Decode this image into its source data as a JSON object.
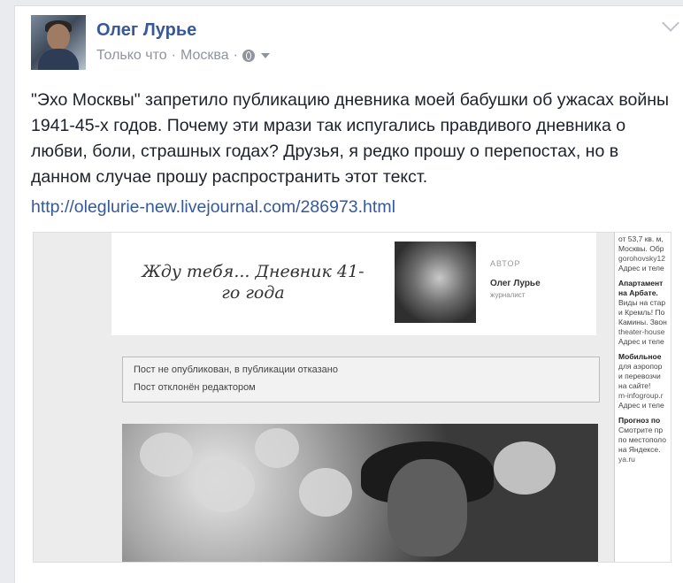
{
  "post": {
    "author": "Олег Лурье",
    "time": "Только что",
    "separator": "·",
    "location": "Москва",
    "privacy_icon": "globe-icon",
    "text": "\"Эхо Москвы\" запретило публикацию дневника моей бабушки об ужасах войны 1941-45-х годов. Почему эти мрази так испугались правдивого дневника о любви, боли, страшных годах? Друзья, я редко прошу о перепостах, но в данном случае прошу распространить этот текст.",
    "link": "http://oleglurie-new.livejournal.com/286973.html"
  },
  "screenshot": {
    "diary_title": "Жду тебя... Дневник 41-го года",
    "author_label": "АВТОР",
    "author_name": "Олег Лурье",
    "author_role": "журналист",
    "notice_1": "Пост не опубликован, в публикации отказано",
    "notice_2": "Пост отклонён редактором"
  },
  "ads": {
    "line_1": "от 53,7 кв. м,",
    "line_2": "Москвы. Обр",
    "line_3": "gorohovsky12",
    "line_4": "Адрес и теле",
    "title_1a": "Апартамент",
    "title_1b": "на Арбате.",
    "line_5": "Виды на стар",
    "line_6": "и Кремль! По",
    "line_7": "Камины. Звон",
    "line_8": "theater-house",
    "line_9": "Адрес и теле",
    "title_2": "Мобильное",
    "line_10": "для аэропор",
    "line_11": "и перевозчи",
    "line_12": "на сайте!",
    "line_13": "m-infogroup.r",
    "line_14": "Адрес и теле",
    "title_3": "Прогноз по",
    "line_15": "Смотрите пр",
    "line_16": "по местополо",
    "line_17": "на Яндексе.",
    "line_18": "ya.ru"
  }
}
